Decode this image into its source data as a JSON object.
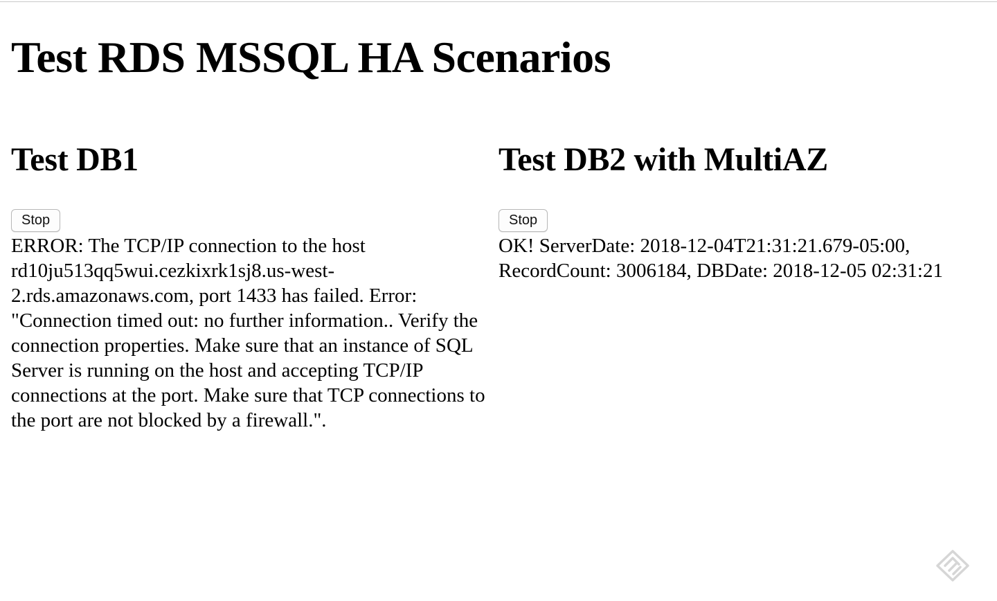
{
  "page": {
    "title": "Test RDS MSSQL HA Scenarios"
  },
  "db1": {
    "title": "Test DB1",
    "stop_label": "Stop",
    "status": "ERROR: The TCP/IP connection to the host rd10ju513qq5wui.cezkixrk1sj8.us-west-2.rds.amazonaws.com, port 1433 has failed. Error: \"Connection timed out: no further information.. Verify the connection properties. Make sure that an instance of SQL Server is running on the host and accepting TCP/IP connections at the port. Make sure that TCP connections to the port are not blocked by a firewall.\"."
  },
  "db2": {
    "title": "Test DB2 with MultiAZ",
    "stop_label": "Stop",
    "status": "OK! ServerDate: 2018-12-04T21:31:21.679-05:00, RecordCount: 3006184, DBDate: 2018-12-05 02:31:21"
  },
  "corner_widget": {
    "icon": "feedback-pencil-icon",
    "color": "#d6d6d6"
  }
}
